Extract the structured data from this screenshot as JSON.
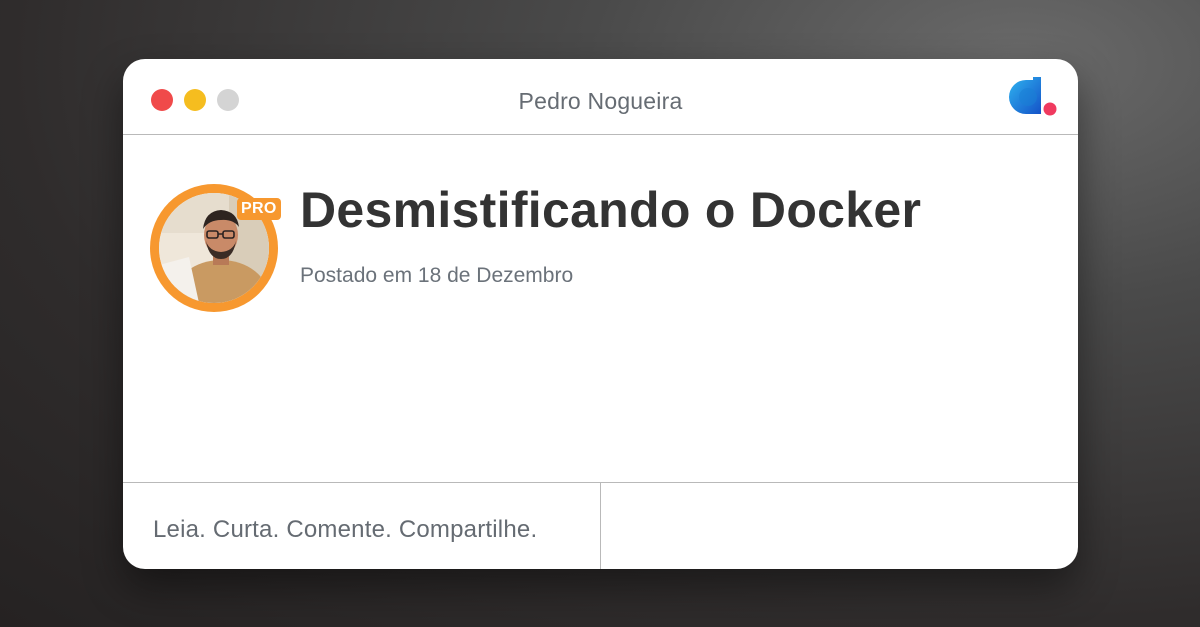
{
  "window": {
    "title": "Pedro Nogueira",
    "controls": [
      "close-dot",
      "minimize-dot",
      "maximize-dot"
    ],
    "logo": "dio-logo"
  },
  "post": {
    "title": "Desmistificando o Docker",
    "posted": "Postado em 18 de Dezembro"
  },
  "author": {
    "badge": "PRO",
    "avatar": "author-avatar-photo"
  },
  "footer": {
    "tagline": "Leia. Curta. Comente. Compartilhe."
  },
  "colors": {
    "accent_orange": "#f7982f",
    "close_red": "#f04a4a",
    "minimize_yellow": "#f5bd1f",
    "maximize_gray": "#d4d4d4",
    "logo_blue": "#1a7fd6",
    "logo_pink": "#f03a5f"
  }
}
